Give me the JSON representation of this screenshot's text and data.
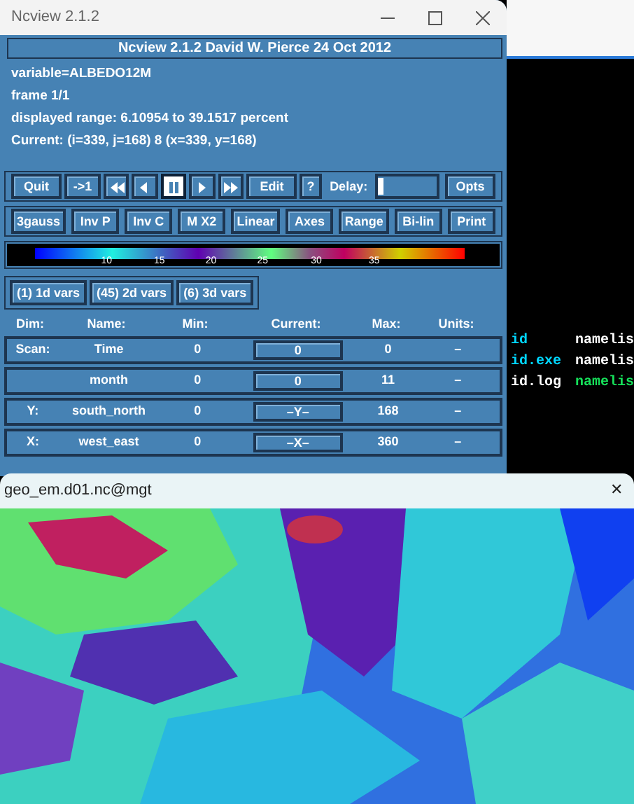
{
  "ncview_window": {
    "title": "Ncview 2.1.2",
    "header": "Ncview 2.1.2 David W. Pierce  24 Oct 2012",
    "info_lines": [
      "variable=ALBEDO12M",
      "frame 1/1",
      "displayed range: 6.10954 to 39.1517 percent",
      "Current: (i=339, j=168) 8 (x=339, y=168)"
    ],
    "control_row": [
      {
        "kind": "button",
        "label": "Quit",
        "selected": false
      },
      {
        "kind": "button",
        "label": "->1",
        "selected": false
      },
      {
        "kind": "rewind",
        "selected": false
      },
      {
        "kind": "back",
        "selected": false
      },
      {
        "kind": "pause",
        "selected": true
      },
      {
        "kind": "forward",
        "selected": false
      },
      {
        "kind": "fastforward",
        "selected": false
      },
      {
        "kind": "button",
        "label": "Edit",
        "selected": false
      },
      {
        "kind": "button",
        "label": "?",
        "selected": false
      },
      {
        "kind": "label",
        "label": "Delay:"
      },
      {
        "kind": "slider",
        "level": 0.0
      },
      {
        "kind": "button",
        "label": "Opts",
        "selected": false
      }
    ],
    "option_row": [
      "3gauss",
      "Inv P",
      "Inv C",
      "M X2",
      "Linear",
      "Axes",
      "Range",
      "Bi-lin",
      "Print"
    ],
    "colorbar_ticks": [
      "10",
      "15",
      "20",
      "25",
      "30",
      "35"
    ],
    "var_buttons": [
      "(1) 1d vars",
      "(45) 2d vars",
      "(6) 3d vars"
    ],
    "dims_table": {
      "columns": [
        "Dim:",
        "Name:",
        "Min:",
        "Current:",
        "Max:",
        "Units:"
      ],
      "rows": [
        {
          "dim": "Scan:",
          "name": "Time",
          "min": "0",
          "current": "0",
          "max": "0",
          "units": "–"
        },
        {
          "name": "month",
          "min": "0",
          "current": "0",
          "max": "11",
          "units": "–"
        },
        {
          "dim": "Y:",
          "name": "south_north",
          "min": "0",
          "current": "–Y–",
          "max": "168",
          "units": "–"
        },
        {
          "dim": "X:",
          "name": "west_east",
          "min": "0",
          "current": "–X–",
          "max": "360",
          "units": "–"
        }
      ]
    }
  },
  "terminal": {
    "lines": [
      [
        {
          "text": "id",
          "color": "#00d7ff"
        },
        {
          "text": "namelis",
          "color": "#ffffff"
        }
      ],
      [
        {
          "text": "id.exe",
          "color": "#00d7ff"
        },
        {
          "text": "namelis",
          "color": "#ffffff"
        }
      ],
      [
        {
          "text": "id.log",
          "color": "#ffffff"
        },
        {
          "text": "namelis",
          "color": "#16e05a"
        }
      ]
    ]
  },
  "image_window": {
    "title": "geo_em.d01.nc@mgt",
    "close": "✕"
  }
}
